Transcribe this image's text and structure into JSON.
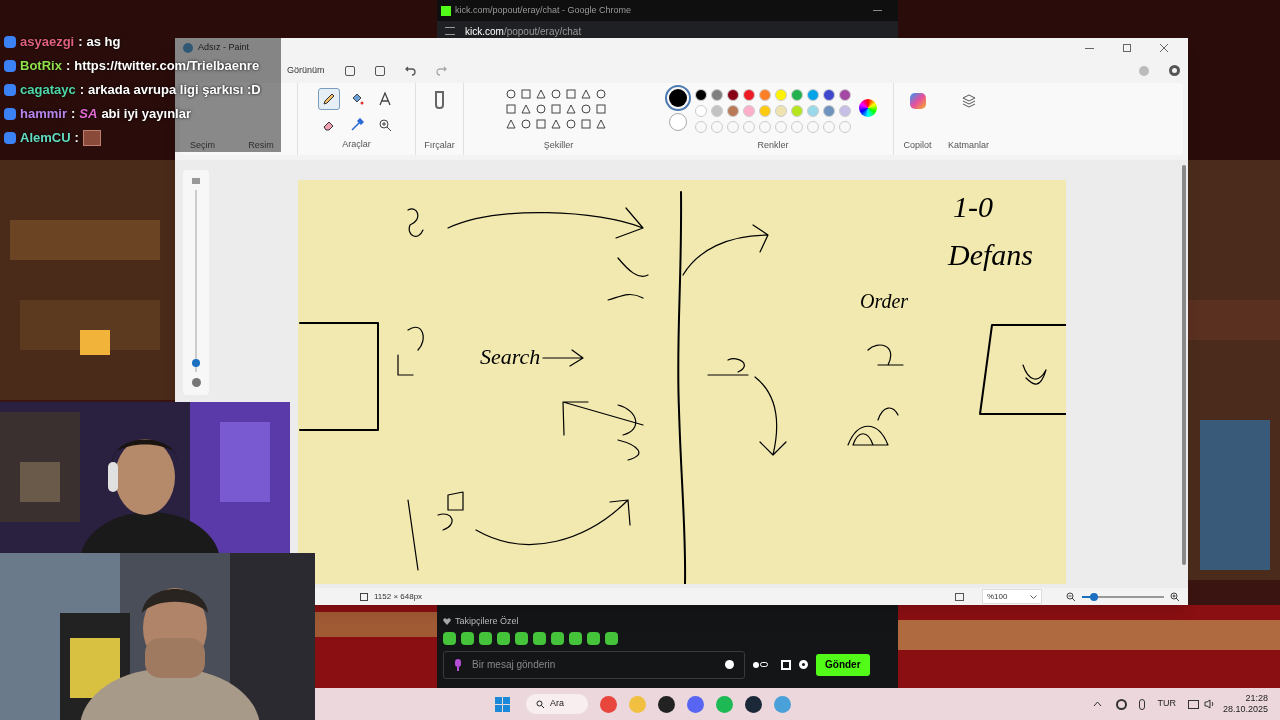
{
  "chat_overlay": {
    "messages": [
      {
        "user": "asyaezgi",
        "color": "#e0607f",
        "separator": ":",
        "text": "as hg"
      },
      {
        "user": "BotRix",
        "color": "#8ee04a",
        "separator": ":",
        "text": "https://twitter.com/Trielbaenre"
      },
      {
        "user": "cagatayc",
        "color": "#4fd6a8",
        "separator": ":",
        "text": "arkada avrupa ligi şarkısı :D"
      },
      {
        "user": "hammir",
        "color": "#b884ec",
        "separator": ":",
        "emote": "SA",
        "text": "abi iyi yayınlar"
      },
      {
        "user": "AlemCU",
        "color": "#62dcc0",
        "separator": ":"
      }
    ]
  },
  "chrome": {
    "title": "kick.com/popout/eray/chat - Google Chrome",
    "url_domain": "kick.com",
    "url_path": "/popout/eray/chat",
    "chat": {
      "emote_set": "Takipçilere Özel",
      "placeholder": "Bir mesaj gönderin",
      "send": "Gönder"
    }
  },
  "paint": {
    "title": "Adsız - Paint",
    "menu": [
      "Görünüm"
    ],
    "groups": {
      "selection": "Seçim",
      "image": "Resim",
      "tools": "Araçlar",
      "brushes": "Fırçalar",
      "shapes": "Şekiller",
      "colors": "Renkler",
      "copilot": "Copilot",
      "layers": "Katmanlar"
    },
    "tools": [
      {
        "kind": "pencil",
        "selected": true
      },
      {
        "kind": "fill",
        "selected": false
      },
      {
        "kind": "text",
        "selected": false
      },
      {
        "kind": "eraser",
        "selected": false
      },
      {
        "kind": "picker",
        "selected": false
      },
      {
        "kind": "zoom",
        "selected": false
      }
    ],
    "primary_color": {
      "color": "#000000"
    },
    "secondary_color": {
      "color": "#ffffff"
    },
    "palette": [
      {
        "color": "#000000"
      },
      {
        "color": "#7f7f7f"
      },
      {
        "color": "#880015"
      },
      {
        "color": "#ed1c24"
      },
      {
        "color": "#ff7f27"
      },
      {
        "color": "#fff200"
      },
      {
        "color": "#22b14c"
      },
      {
        "color": "#00a2e8"
      },
      {
        "color": "#3f48cc"
      },
      {
        "color": "#a349a4"
      },
      {
        "color": "#ffffff"
      },
      {
        "color": "#c3c3c3"
      },
      {
        "color": "#b97a57"
      },
      {
        "color": "#ffaec9"
      },
      {
        "color": "#ffc90e"
      },
      {
        "color": "#efe4b0"
      },
      {
        "color": "#b5e61d"
      },
      {
        "color": "#99d9ea"
      },
      {
        "color": "#7092be"
      },
      {
        "color": "#c8bfe7"
      }
    ],
    "size_slider": {
      "level": 0.03
    },
    "canvas": {
      "notes": [
        {
          "text": "1-0"
        },
        {
          "text": "Defans"
        },
        {
          "text": "Order"
        },
        {
          "text": "Search"
        }
      ]
    },
    "status": {
      "size": "1152 × 648px",
      "zoom": "%100",
      "zoom_slider": {
        "level": 0.15
      }
    }
  },
  "taskbar": {
    "search": "Ara",
    "language": "TUR",
    "time": "21:28",
    "date": "28.10.2025"
  }
}
